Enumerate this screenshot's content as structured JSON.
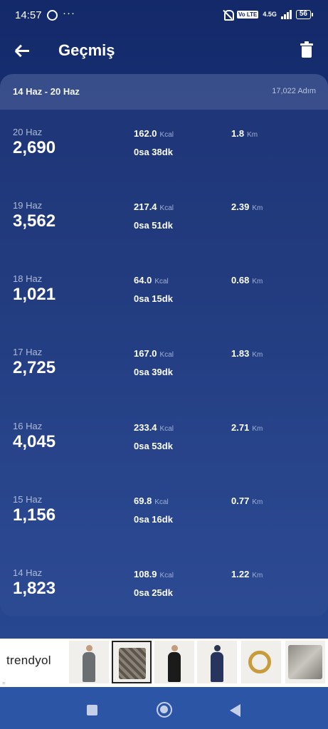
{
  "status_bar": {
    "time": "14:57",
    "network": "4.5G",
    "volte": "Vo LTE",
    "battery": "56"
  },
  "header": {
    "title": "Geçmiş",
    "back_icon": "arrow-left-icon",
    "delete_icon": "trash-icon"
  },
  "week": {
    "range": "14 Haz - 20 Haz",
    "total": "17,022 Adım"
  },
  "days": [
    {
      "date": "20 Haz",
      "steps": "2,690",
      "kcal": "162.0",
      "kcal_unit": "Kcal",
      "time": "0sa 38dk",
      "km": "1.8",
      "km_unit": "Km"
    },
    {
      "date": "19 Haz",
      "steps": "3,562",
      "kcal": "217.4",
      "kcal_unit": "Kcal",
      "time": "0sa 51dk",
      "km": "2.39",
      "km_unit": "Km"
    },
    {
      "date": "18 Haz",
      "steps": "1,021",
      "kcal": "64.0",
      "kcal_unit": "Kcal",
      "time": "0sa 15dk",
      "km": "0.68",
      "km_unit": "Km"
    },
    {
      "date": "17 Haz",
      "steps": "2,725",
      "kcal": "167.0",
      "kcal_unit": "Kcal",
      "time": "0sa 39dk",
      "km": "1.83",
      "km_unit": "Km"
    },
    {
      "date": "16 Haz",
      "steps": "4,045",
      "kcal": "233.4",
      "kcal_unit": "Kcal",
      "time": "0sa 53dk",
      "km": "2.71",
      "km_unit": "Km"
    },
    {
      "date": "15 Haz",
      "steps": "1,156",
      "kcal": "69.8",
      "kcal_unit": "Kcal",
      "time": "0sa 16dk",
      "km": "0.77",
      "km_unit": "Km"
    },
    {
      "date": "14 Haz",
      "steps": "1,823",
      "kcal": "108.9",
      "kcal_unit": "Kcal",
      "time": "0sa 25dk",
      "km": "1.22",
      "km_unit": "Km"
    }
  ],
  "ad": {
    "brand": "trendyol",
    "marker": "="
  },
  "colors": {
    "background_top": "#13296a",
    "background_bottom": "#2a4c95",
    "nav_bar": "#2d55a6"
  }
}
